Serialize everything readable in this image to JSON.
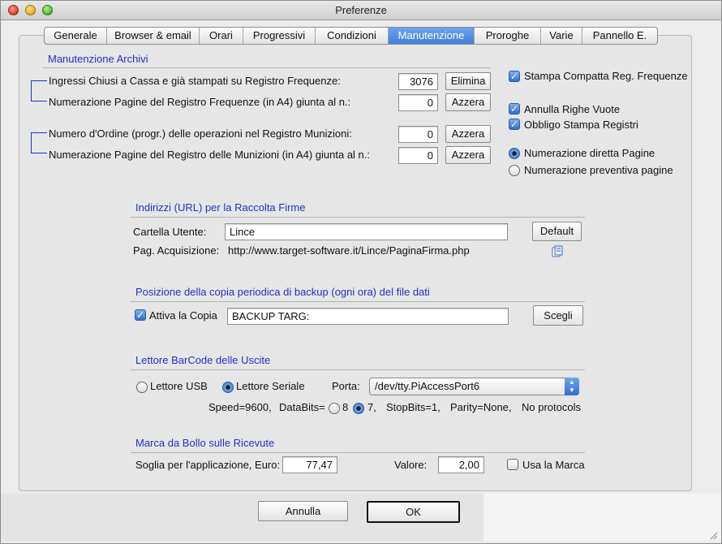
{
  "window": {
    "title": "Preferenze"
  },
  "tabs": [
    {
      "label": "Generale",
      "active": false
    },
    {
      "label": "Browser & email",
      "active": false
    },
    {
      "label": "Orari",
      "active": false
    },
    {
      "label": "Progressivi",
      "active": false
    },
    {
      "label": "Condizioni",
      "active": false
    },
    {
      "label": "Manutenzione",
      "active": true
    },
    {
      "label": "Proroghe",
      "active": false
    },
    {
      "label": "Varie",
      "active": false
    },
    {
      "label": "Pannello E.",
      "active": false
    }
  ],
  "maintenance": {
    "section_title": "Manutenzione Archivi",
    "rows": [
      {
        "label": "Ingressi Chiusi a Cassa e già stampati su Registro Frequenze:",
        "value": "3076",
        "button": "Elimina"
      },
      {
        "label": "Numerazione Pagine del Registro Frequenze (in A4) giunta al n.:",
        "value": "0",
        "button": "Azzera"
      },
      {
        "label": "Numero d'Ordine (progr.) delle operazioni nel Registro Munizioni:",
        "value": "0",
        "button": "Azzera"
      },
      {
        "label": "Numerazione Pagine del Registro delle Munizioni (in A4) giunta al n.:",
        "value": "0",
        "button": "Azzera"
      }
    ],
    "options": {
      "stampa_compatta": {
        "label": "Stampa Compatta Reg. Frequenze",
        "checked": true
      },
      "annulla_righe": {
        "label": "Annulla Righe Vuote",
        "checked": true
      },
      "obbligo_stampa": {
        "label": "Obbligo Stampa Registri",
        "checked": true
      },
      "num_diretta": {
        "label": "Numerazione diretta Pagine",
        "selected": true
      },
      "num_preventiva": {
        "label": "Numerazione preventiva pagine",
        "selected": false
      }
    }
  },
  "signatures": {
    "section_title": "Indirizzi (URL) per la Raccolta Firme",
    "user_folder_label": "Cartella Utente:",
    "user_folder_value": "Lince",
    "default_button": "Default",
    "acquisition_label": "Pag. Acquisizione:",
    "acquisition_url": "http://www.target-software.it/Lince/PaginaFirma.php",
    "copy_icon": "copy-icon"
  },
  "backup": {
    "section_title": "Posizione della copia periodica di backup (ogni ora) del file dati",
    "enable_label": "Attiva la Copia",
    "enabled": true,
    "path_value": "BACKUP TARG:",
    "choose_button": "Scegli"
  },
  "barcode": {
    "section_title": "Lettore BarCode delle Uscite",
    "usb_label": "Lettore USB",
    "usb_selected": false,
    "serial_label": "Lettore Seriale",
    "serial_selected": true,
    "port_label": "Porta:",
    "port_value": "/dev/tty.PiAccessPort6",
    "speed_text": "Speed=9600,",
    "databits_label": "DataBits=",
    "databits_8": "8",
    "databits_7": "7,",
    "databits_selected": "7",
    "stopbits_text": "StopBits=1,",
    "parity_text": "Parity=None,",
    "protocol_text": "No protocols"
  },
  "stamp": {
    "section_title": "Marca da Bollo sulle Ricevute",
    "threshold_label": "Soglia per l'applicazione, Euro:",
    "threshold_value": "77,47",
    "value_label": "Valore:",
    "value_value": "2,00",
    "use_label": "Usa la Marca",
    "use_checked": false
  },
  "footer": {
    "cancel_button": "Annulla",
    "ok_button": "OK"
  },
  "colors": {
    "accent": "#3d7fd9",
    "section_title": "#1d33c8",
    "bracket": "#1d33c8"
  }
}
